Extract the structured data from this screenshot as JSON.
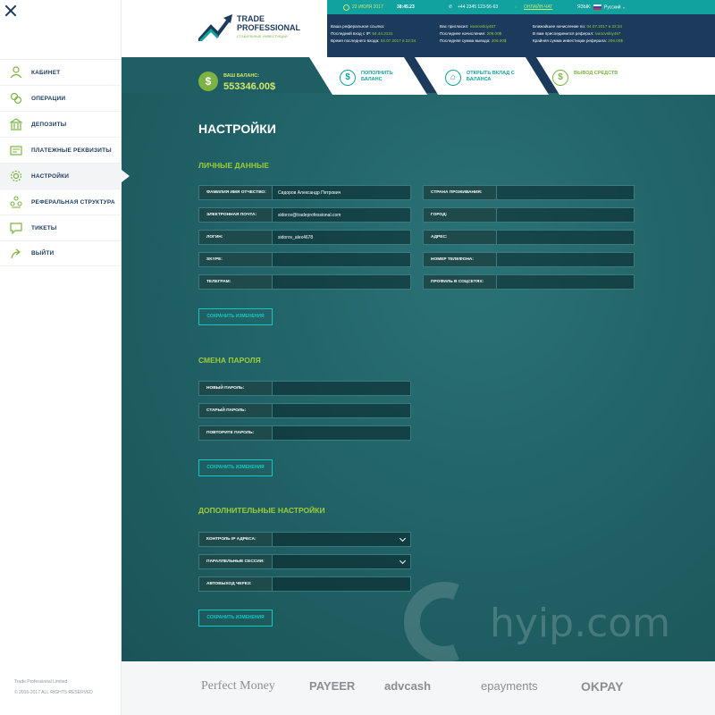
{
  "sidebar": {
    "items": [
      {
        "label": "КАБИНЕТ",
        "icon": "user-icon"
      },
      {
        "label": "ОПЕРАЦИИ",
        "icon": "operations-icon"
      },
      {
        "label": "ДЕПОЗИТЫ",
        "icon": "bank-icon"
      },
      {
        "label": "ПЛАТЕЖНЫЕ РЕКВИЗИТЫ",
        "icon": "wallet-icon"
      },
      {
        "label": "НАСТРОЙКИ",
        "icon": "gear-icon",
        "active": true
      },
      {
        "label": "РЕФЕРАЛЬНАЯ СТРУКТУРА",
        "icon": "referral-icon"
      },
      {
        "label": "ТИКЕТЫ",
        "icon": "chat-icon"
      },
      {
        "label": "ВЫЙТИ",
        "icon": "logout-icon"
      }
    ],
    "footer_company": "Trade Professional Limited",
    "footer_copy": "© 2016-2017 ALL RIGHTS RESERVED"
  },
  "header": {
    "logo_title": "TRADE PROFESSIONAL",
    "logo_sub": "СТАБИЛЬНЫЕ ИНВЕСТИЦИИ",
    "date": "22 ИЮЛЯ 2017",
    "time": "38:45.23",
    "phone": "+44 2345 123-56-63",
    "chat": "ОНЛАЙН-ЧАТ",
    "lang_label": "ЯЗЫК:",
    "lang": "Русский",
    "info": {
      "ref_link_label": "Ваша реферальная ссылка:",
      "last_ip_label": "Последний вход с IP:",
      "last_ip_value": "54.44.2131",
      "last_login_label": "Время последнего входа:",
      "last_login_value": "04.07.2017 в 22:34",
      "invited_label": "Вас пригласил:",
      "invited_value": "ivanovskiy467",
      "last_accrual_label": "Последнее начисление:",
      "last_accrual_value": "206.00$",
      "last_withdraw_label": "Последняя сумма вывода:",
      "last_withdraw_value": "206.00$",
      "next_accrual_label": "Ближайшее начисление по:",
      "next_accrual_value": "04.07.2017 в 22:34",
      "joined_ref_label": "В вам присоединился реферал:",
      "joined_ref_value": "ivanovskiy467",
      "ref_invest_label": "Крайняя сумма инвестиции реферала:",
      "ref_invest_value": "206.00$"
    }
  },
  "balance": {
    "label": "ВАШ БАЛАНС:",
    "value": "553346.00$"
  },
  "actions": [
    {
      "label": "ПОПОЛНИТЬ БАЛАНС",
      "icon": "dollar-icon"
    },
    {
      "label": "ОТКРЫТЬ ВКЛАД С БАЛАНСА",
      "icon": "bank-icon"
    },
    {
      "label": "ВЫВОД СРЕДСТВ",
      "icon": "dollar-icon"
    }
  ],
  "page": {
    "title": "НАСТРОЙКИ"
  },
  "personal": {
    "title": "ЛИЧНЫЕ ДАННЫЕ",
    "left": [
      {
        "label": "ФАМИЛИЯ ИМЯ ОТЧЕСТВО:",
        "value": "Сидоров Александр Петрович"
      },
      {
        "label": "ЭЛЕКТРОННАЯ ПОЧТА:",
        "value": "sidorov@tradeprofessional.com"
      },
      {
        "label": "ЛОГИН:",
        "value": "sidorov_alex4678"
      },
      {
        "label": "SKYPE:",
        "value": ""
      },
      {
        "label": "ТЕЛЕГРАМ:",
        "value": ""
      }
    ],
    "right": [
      {
        "label": "СТРАНА ПРОЖИВАНИЯ:",
        "value": ""
      },
      {
        "label": "ГОРОД:",
        "value": ""
      },
      {
        "label": "АДРЕС:",
        "value": ""
      },
      {
        "label": "НОМЕР ТЕЛЕФОНА:",
        "value": ""
      },
      {
        "label": "ПРОФИЛЬ В СОЦСЕТЯХ:",
        "value": ""
      }
    ],
    "save": "СОХРАНИТЬ ИЗМЕНЕНИЯ"
  },
  "password": {
    "title": "СМЕНА ПАРОЛЯ",
    "fields": [
      {
        "label": "НОВЫЙ ПАРОЛЬ:"
      },
      {
        "label": "СТАРЫЙ ПАРОЛЬ:"
      },
      {
        "label": "ПОВТОРИТЕ ПАРОЛЬ:"
      }
    ],
    "save": "СОХРАНИТЬ ИЗМЕНЕНИЯ"
  },
  "extra": {
    "title": "ДОПОЛНИТЕЛЬНЫЕ НАСТРОЙКИ",
    "fields": [
      {
        "label": "КОНТРОЛЬ IP АДРЕСА:"
      },
      {
        "label": "ПАРАЛЛЕЛЬНЫЕ СЕССИИ:"
      },
      {
        "label": "АВТОВЫХОД ЧЕРЕЗ:"
      }
    ],
    "save": "СОХРАНИТЬ ИЗМЕНЕНИЯ"
  },
  "watermark": "hyip.com",
  "payments": [
    "Perfect Money",
    "PAYEER",
    "advcash",
    "epayments",
    "OKPAY"
  ]
}
